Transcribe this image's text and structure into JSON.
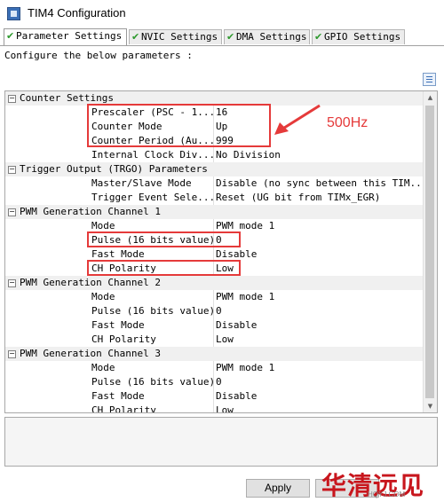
{
  "window": {
    "title": "TIM4 Configuration"
  },
  "tabs": [
    {
      "label": "Parameter Settings",
      "active": true
    },
    {
      "label": "NVIC Settings",
      "active": false
    },
    {
      "label": "DMA Settings",
      "active": false
    },
    {
      "label": "GPIO Settings",
      "active": false
    }
  ],
  "description": "Configure the below parameters :",
  "grid": {
    "view_icon": "categorized-view-icon",
    "groups": [
      {
        "title": "Counter Settings",
        "rows": [
          {
            "name": "Prescaler (PSC - 1...",
            "value": "16"
          },
          {
            "name": "Counter Mode",
            "value": "Up"
          },
          {
            "name": "Counter Period (Au...",
            "value": "999"
          },
          {
            "name": "Internal Clock Div...",
            "value": "No Division"
          }
        ]
      },
      {
        "title": "Trigger Output (TRGO) Parameters",
        "rows": [
          {
            "name": "Master/Slave Mode",
            "value": "Disable (no sync between this TIM..."
          },
          {
            "name": "Trigger Event Sele...",
            "value": "Reset (UG bit from TIMx_EGR)"
          }
        ]
      },
      {
        "title": "PWM Generation Channel 1",
        "rows": [
          {
            "name": "Mode",
            "value": "PWM mode 1"
          },
          {
            "name": "Pulse (16 bits value)",
            "value": "0"
          },
          {
            "name": "Fast Mode",
            "value": "Disable"
          },
          {
            "name": "CH Polarity",
            "value": "Low"
          }
        ]
      },
      {
        "title": "PWM Generation Channel 2",
        "rows": [
          {
            "name": "Mode",
            "value": "PWM mode 1"
          },
          {
            "name": "Pulse (16 bits value)",
            "value": "0"
          },
          {
            "name": "Fast Mode",
            "value": "Disable"
          },
          {
            "name": "CH Polarity",
            "value": "Low"
          }
        ]
      },
      {
        "title": "PWM Generation Channel 3",
        "rows": [
          {
            "name": "Mode",
            "value": "PWM mode 1"
          },
          {
            "name": "Pulse (16 bits value)",
            "value": "0"
          },
          {
            "name": "Fast Mode",
            "value": "Disable"
          },
          {
            "name": "CH Polarity",
            "value": "Low"
          }
        ]
      }
    ]
  },
  "buttons": {
    "apply": "Apply"
  },
  "annotation": {
    "label": "500Hz",
    "color": "#e53a3a"
  },
  "watermark": {
    "text": "华清远见",
    "sub": "HQYJ.COM"
  },
  "colors": {
    "check": "#2e9a2e",
    "highlight": "#e53a3a",
    "watermark": "#c8161d"
  }
}
